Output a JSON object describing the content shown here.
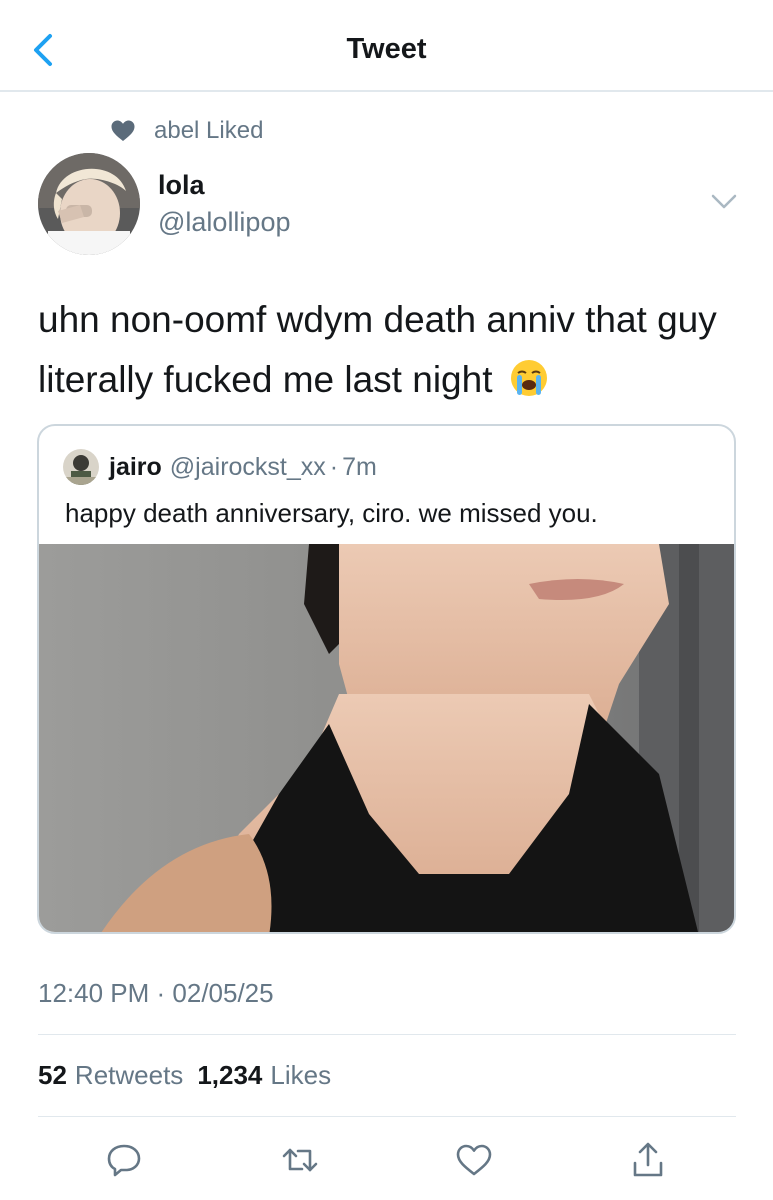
{
  "nav": {
    "title": "Tweet",
    "back_icon": "chevron-left-icon"
  },
  "social_context": {
    "icon": "heart-filled-icon",
    "text": "abel Liked"
  },
  "author": {
    "name": "lola",
    "handle": "@lalollipop"
  },
  "tweet": {
    "text": "uhn non-oomf wdym death anniv that guy literally fucked me last night",
    "emoji": "loudly-crying-face"
  },
  "quote": {
    "name": "jairo",
    "handle": "@jairockst_xx",
    "separator": "·",
    "time": "7m",
    "text": "happy death anniversary, ciro. we missed you."
  },
  "meta": {
    "timestamp": "12:40 PM · 02/05/25"
  },
  "stats": {
    "retweets_count": "52",
    "retweets_label": "Retweets",
    "likes_count": "1,234",
    "likes_label": "Likes"
  },
  "actions": [
    "reply-icon",
    "retweet-icon",
    "like-icon",
    "share-icon"
  ],
  "colors": {
    "accent": "#1da1f2",
    "secondary_text": "#657786",
    "divider": "#e1e8ed"
  }
}
